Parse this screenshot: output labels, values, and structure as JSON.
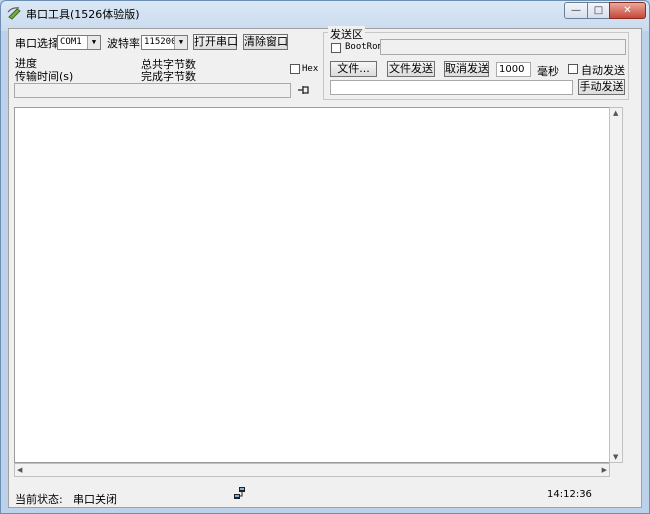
{
  "window": {
    "title": "串口工具(1526体验版)",
    "buttons": {
      "minimize": "—",
      "maximize": "□",
      "close": "✕"
    }
  },
  "serial": {
    "port_label": "串口选择",
    "port_value": "COM1",
    "baud_label": "波特率",
    "baud_value": "115200",
    "open_button": "打开串口",
    "clear_button": "清除窗口"
  },
  "progress": {
    "progress_label": "进度",
    "time_label": "传输时间(s)",
    "total_bytes_label": "总共字节数",
    "done_bytes_label": "完成字节数",
    "hex_label": "Hex"
  },
  "send_area": {
    "group_title": "发送区",
    "bootrom_label": "BootRom",
    "bootrom_value": "",
    "file_button": "文件...",
    "file_send_button": "文件发送",
    "cancel_send_button": "取消发送",
    "interval_value": "1000",
    "interval_unit": "毫秒",
    "auto_send_label": "自动发送",
    "send_input_value": "",
    "manual_send_button": "手动发送"
  },
  "receive": {
    "content": ""
  },
  "status_bar": {
    "state_label": "当前状态:",
    "state_value": "串口关闭",
    "time": "14:12:36"
  }
}
